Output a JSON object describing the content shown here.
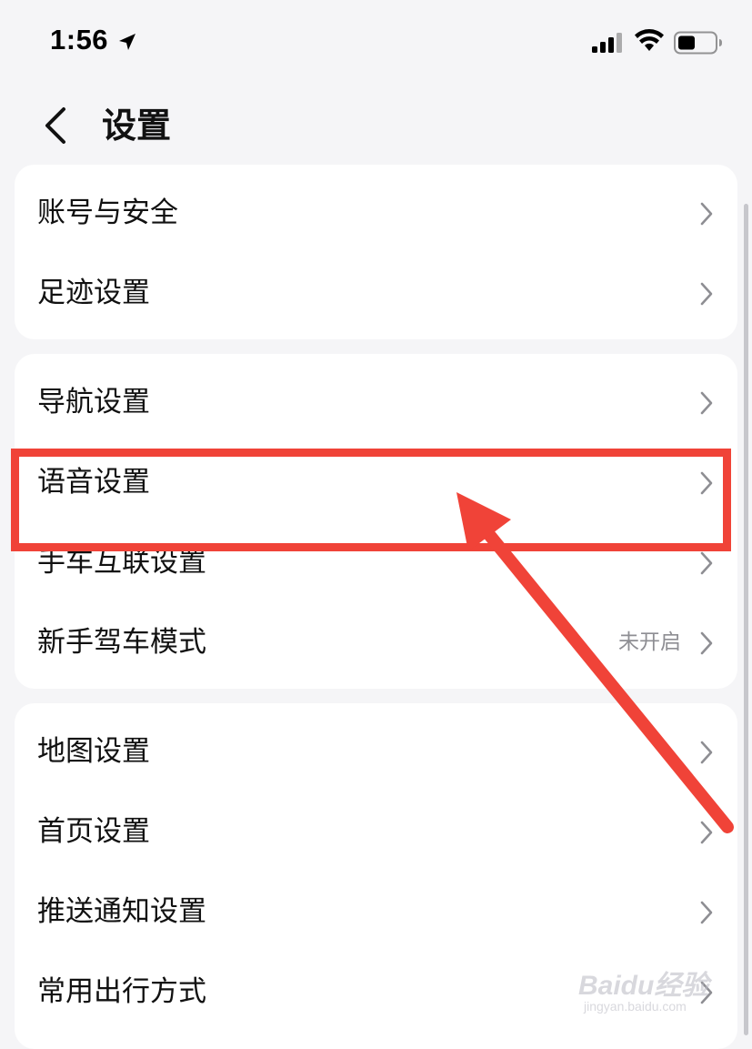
{
  "status_bar": {
    "time": "1:56",
    "icons": [
      "location-arrow-icon",
      "cellular-signal-icon",
      "wifi-icon",
      "battery-icon"
    ]
  },
  "header": {
    "title": "设置",
    "back_icon": "chevron-left-icon"
  },
  "groups": [
    {
      "items": [
        {
          "label": "账号与安全",
          "icon": "chevron-right-icon"
        },
        {
          "label": "足迹设置",
          "icon": "chevron-right-icon"
        }
      ]
    },
    {
      "items": [
        {
          "label": "导航设置",
          "icon": "chevron-right-icon"
        },
        {
          "label": "语音设置",
          "icon": "chevron-right-icon",
          "highlighted": true
        },
        {
          "label": "手车互联设置",
          "icon": "chevron-right-icon"
        },
        {
          "label": "新手驾车模式",
          "value": "未开启",
          "icon": "chevron-right-icon"
        }
      ]
    },
    {
      "items": [
        {
          "label": "地图设置",
          "icon": "chevron-right-icon"
        },
        {
          "label": "首页设置",
          "icon": "chevron-right-icon"
        },
        {
          "label": "推送通知设置",
          "icon": "chevron-right-icon"
        },
        {
          "label": "常用出行方式",
          "icon": "chevron-right-icon"
        }
      ]
    }
  ],
  "annotation": {
    "color": "#f04338",
    "type": "red-box-with-arrow"
  },
  "watermark": {
    "text": "Baidu经验",
    "sub": "jingyan.baidu.com"
  },
  "colors": {
    "background": "#f5f5f7",
    "card": "#ffffff",
    "secondary_text": "#8e8e93",
    "chevron": "#8e8e93"
  }
}
